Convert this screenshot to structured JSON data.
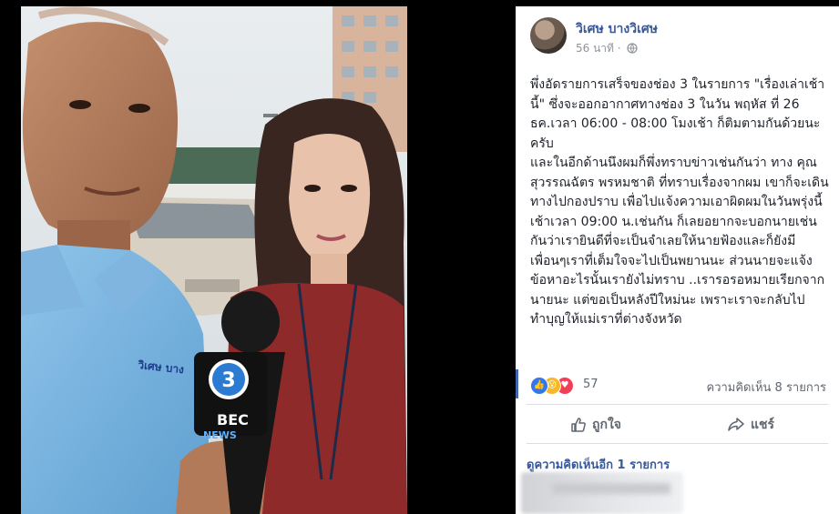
{
  "post": {
    "author": "วิเศษ บางวิเศษ",
    "time": "56 นาที",
    "paragraphs": [
      "พึ่งอัดรายการเสร็จของช่อง 3 ในรายการ \"เรื่องเล่าเช้านี้\" ซึ่งจะออกอากาศทางช่อง 3 ในวัน พฤหัส ที่ 26 ธค.เวลา 06:00 - 08:00 โมงเช้า ก็ติมตามกันด้วยนะครับ",
      "และในอีกด้านนึงผมก็พึ่งทราบข่าวเช่นกันว่า ทาง คุณสุวรรณฉัตร พรหมชาติ ที่ทราบเรื่องจากผม เขาก็จะเดินทางไปกองปราบ เพื่อไปแจ้งความเอาผิดผมในวันพรุ่งนี้เช้าเวลา 09:00 น.เช่นกัน ก็เลยอยากจะบอกนายเช่นกันว่าเรายินดีที่จะเป็นจำเลยให้นายฟ้องและก็ยังมีเพื่อนๆเราที่เต็มใจจะไปเป็นพยานนะ ส่วนนายจะแจ้งข้อหาอะไรนั้นเรายังไม่ทราบ ..เรารอรอหมายเรียกจากนายนะ แต่ขอเป็นหลังปีใหม่นะ เพราะเราจะกลับไปทำบุญให้แม่เราที่ต่างจังหวัด"
    ],
    "reaction_count": "57",
    "comment_count": "ความคิดเห็น 8 รายการ",
    "like_label": "ถูกใจ",
    "share_label": "แชร์",
    "more_comments": "ดูความคิดเห็นอีก 1 รายการ"
  },
  "photo": {
    "mic_channel": "3",
    "mic_brand": "BEC",
    "mic_sub": "NEWS",
    "shirt_text": "วิเศษ บาง"
  },
  "colors": {
    "link": "#385898",
    "like": "#3578e5",
    "wow": "#f7b928",
    "love": "#f33e58"
  }
}
